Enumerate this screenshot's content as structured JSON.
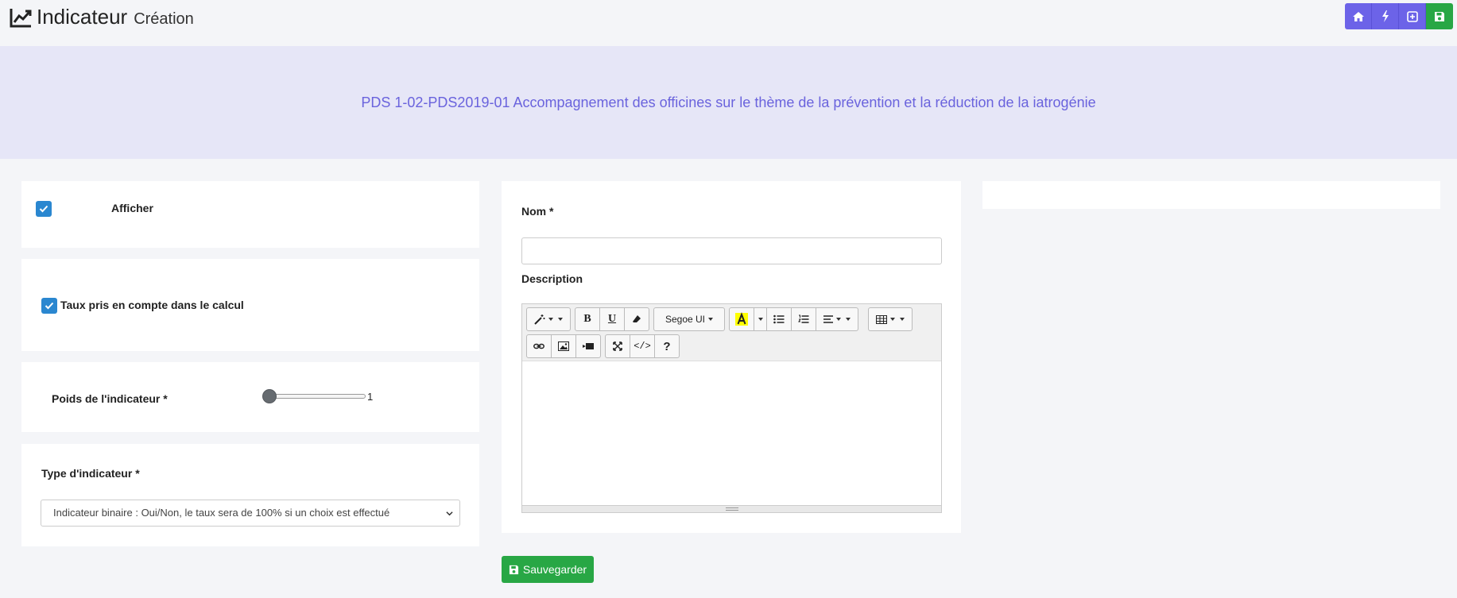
{
  "header": {
    "title": "Indicateur",
    "subtitle": "Création",
    "toolbar": [
      {
        "name": "home-icon"
      },
      {
        "name": "bolt-icon"
      },
      {
        "name": "plus-square-icon"
      },
      {
        "name": "save-icon"
      }
    ]
  },
  "banner": {
    "text": "PDS 1-02-PDS2019-01 Accompagnement des officines sur le thème de la prévention et la réduction de la iatrogénie"
  },
  "left": {
    "afficher": {
      "label": "Afficher",
      "checked": true
    },
    "taux": {
      "label": "Taux pris en compte dans le calcul",
      "checked": true
    },
    "poids": {
      "label": "Poids de l'indicateur *",
      "value": "1"
    },
    "type": {
      "label": "Type d'indicateur *",
      "selected": "Indicateur binaire : Oui/Non, le taux sera de 100% si un choix est effectué"
    }
  },
  "form": {
    "nom_label": "Nom *",
    "nom_value": "",
    "description_label": "Description",
    "font_select": "Segoe UI",
    "save_label": "Sauvegarder"
  },
  "colors": {
    "accent": "#6c63e8",
    "success": "#28a745",
    "banner_bg": "#e6e6f7",
    "banner_text": "#6a63dd",
    "checkbox": "#2a87d0"
  }
}
